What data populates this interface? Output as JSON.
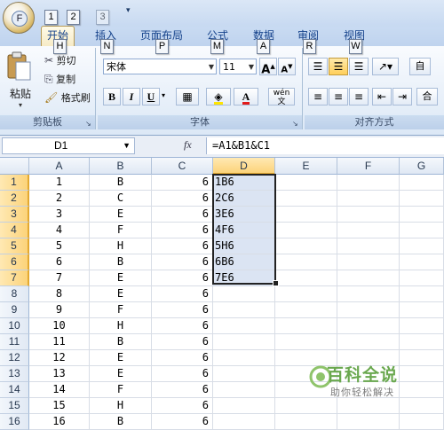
{
  "office_button_label": "F",
  "quick_access_keytips": [
    "1",
    "2",
    "3"
  ],
  "tabs": [
    {
      "label": "开始",
      "keytip": "H"
    },
    {
      "label": "插入",
      "keytip": "N"
    },
    {
      "label": "页面布局",
      "keytip": "P"
    },
    {
      "label": "公式",
      "keytip": "M"
    },
    {
      "label": "数据",
      "keytip": "A"
    },
    {
      "label": "审阅",
      "keytip": "R"
    },
    {
      "label": "视图",
      "keytip": "W"
    }
  ],
  "ribbon": {
    "clipboard": {
      "paste": "粘贴",
      "cut": "剪切",
      "copy": "复制",
      "format_painter": "格式刷",
      "label": "剪贴板"
    },
    "font": {
      "font_name": "宋体",
      "font_size": "11",
      "label": "字体",
      "bold": "B",
      "italic": "I",
      "underline": "U",
      "grow": "A",
      "shrink": "A",
      "phonetic": "wén"
    },
    "alignment": {
      "label": "对齐方式",
      "wrap_fragment": "自",
      "merge_fragment": "合"
    }
  },
  "formula_bar": {
    "name_box": "D1",
    "fx": "fx",
    "formula": "=A1&B1&C1"
  },
  "columns": [
    "A",
    "B",
    "C",
    "D",
    "E",
    "F",
    "G"
  ],
  "selected_column": "D",
  "rows": [
    {
      "n": "1",
      "a": "1",
      "b": "B",
      "c": "6",
      "d": "1B6"
    },
    {
      "n": "2",
      "a": "2",
      "b": "C",
      "c": "6",
      "d": "2C6"
    },
    {
      "n": "3",
      "a": "3",
      "b": "E",
      "c": "6",
      "d": "3E6"
    },
    {
      "n": "4",
      "a": "4",
      "b": "F",
      "c": "6",
      "d": "4F6"
    },
    {
      "n": "5",
      "a": "5",
      "b": "H",
      "c": "6",
      "d": "5H6"
    },
    {
      "n": "6",
      "a": "6",
      "b": "B",
      "c": "6",
      "d": "6B6"
    },
    {
      "n": "7",
      "a": "7",
      "b": "E",
      "c": "6",
      "d": "7E6"
    },
    {
      "n": "8",
      "a": "8",
      "b": "E",
      "c": "6",
      "d": ""
    },
    {
      "n": "9",
      "a": "9",
      "b": "F",
      "c": "6",
      "d": ""
    },
    {
      "n": "10",
      "a": "10",
      "b": "H",
      "c": "6",
      "d": ""
    },
    {
      "n": "11",
      "a": "11",
      "b": "B",
      "c": "6",
      "d": ""
    },
    {
      "n": "12",
      "a": "12",
      "b": "E",
      "c": "6",
      "d": ""
    },
    {
      "n": "13",
      "a": "13",
      "b": "E",
      "c": "6",
      "d": ""
    },
    {
      "n": "14",
      "a": "14",
      "b": "F",
      "c": "6",
      "d": ""
    },
    {
      "n": "15",
      "a": "15",
      "b": "H",
      "c": "6",
      "d": ""
    },
    {
      "n": "16",
      "a": "16",
      "b": "B",
      "c": "6",
      "d": ""
    }
  ],
  "selected_rows": [
    "1",
    "2",
    "3",
    "4",
    "5",
    "6",
    "7"
  ],
  "watermark": {
    "title": "百科全说",
    "subtitle": "助你轻松解决"
  },
  "colors": {
    "accent": "#15428b",
    "selection_fill": "#dbe4f3",
    "header_selected": "#fcd37a",
    "watermark_green": "#6aa84f"
  }
}
